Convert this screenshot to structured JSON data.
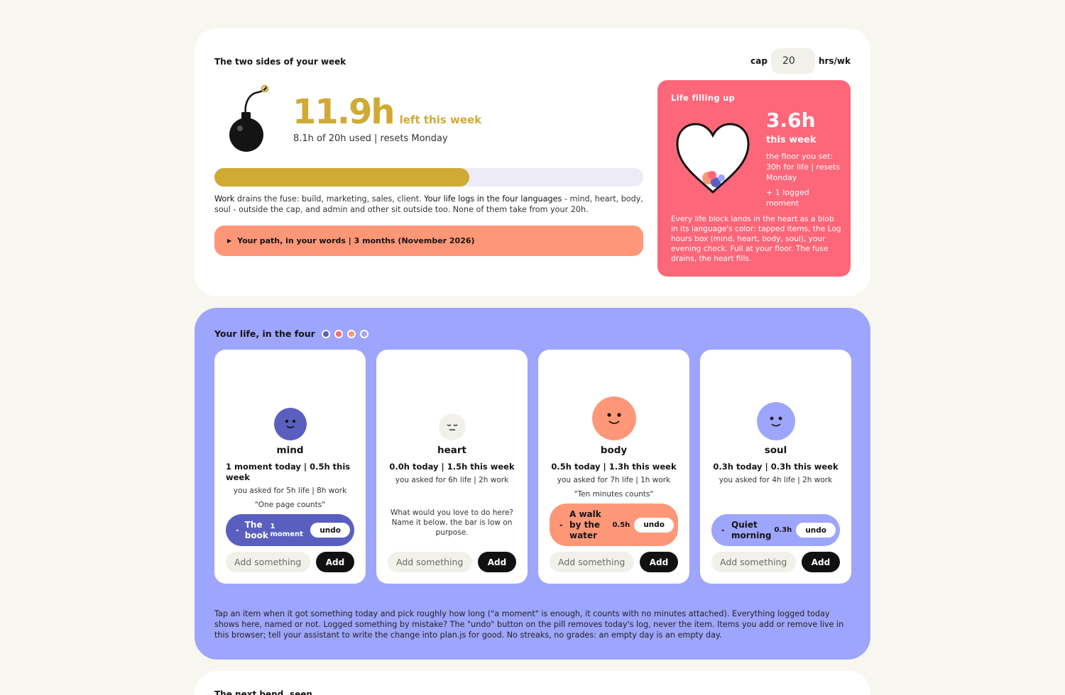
{
  "week": {
    "title": "The two sides of your week",
    "cap_label": "cap",
    "cap_value": "20",
    "cap_unit": "hrs/wk",
    "left_value": "11.9h",
    "left_label": "left this week",
    "used_text": "8.1h of 20h used | resets Monday",
    "used_fraction": 0.595,
    "explain_work": "Work",
    "explain_1": " drains the fuse: build, marketing, sales, client. ",
    "explain_life": "Your life logs in the four languages",
    "explain_2": " - mind, heart, body, soul - outside the cap, and admin and other sit outside too. None of them take from your 20h.",
    "path_label": "Your path, in your words | 3 months (November 2026)"
  },
  "life": {
    "title": "Life filling up",
    "value": "3.6h",
    "week_label": "this week",
    "floor_text": "the floor you set: 30h for life | resets Monday",
    "logged_text": "+ 1 logged moment",
    "desc": "Every life block lands in the heart as a blob in its language's color: tapped items, the Log hours box (mind, heart, body, soul), your evening check. Full at your floor. The fuse drains, the heart fills."
  },
  "four": {
    "title": "Your life, in the four",
    "colors": [
      "#5a5fbf",
      "#fe6679",
      "#fe9778",
      "#9ea5fc"
    ],
    "cards": [
      {
        "name": "mind",
        "stats": "1 moment today | 0.5h this week",
        "asked": "you asked for 5h life | 8h work",
        "quote": "\"One page counts\"",
        "pill_name": "The book",
        "pill_amount": "1 moment",
        "undo": "undo",
        "add_placeholder": "Add something you love",
        "add_label": "Add"
      },
      {
        "name": "heart",
        "stats": "0.0h today | 1.5h this week",
        "asked": "you asked for 6h life | 2h work",
        "prompt": "What would you love to do here? Name it below, the bar is low on purpose.",
        "add_placeholder": "Add something you love",
        "add_label": "Add"
      },
      {
        "name": "body",
        "stats": "0.5h today | 1.3h this week",
        "asked": "you asked for 7h life | 1h work",
        "quote": "\"Ten minutes counts\"",
        "pill_name": "A walk by the water",
        "pill_amount": "0.5h",
        "undo": "undo",
        "add_placeholder": "Add something you love",
        "add_label": "Add"
      },
      {
        "name": "soul",
        "stats": "0.3h today | 0.3h this week",
        "asked": "you asked for 4h life | 2h work",
        "pill_name": "Quiet morning",
        "pill_amount": "0.3h",
        "undo": "undo",
        "add_placeholder": "Add something you love",
        "add_label": "Add"
      }
    ],
    "tap_text": "Tap an item when it got something today and pick roughly how long (\"a moment\" is enough, it counts with no minutes attached). Everything logged today shows here, named or not. Logged something by mistake? The \"undo\" button on the pill removes today's log, never the item. Items you add or remove live in this browser; tell your assistant to write the change into plan.js for good. No streaks, no grades: an empty day is an empty day."
  },
  "next": {
    "title": "The next bend, seen"
  }
}
